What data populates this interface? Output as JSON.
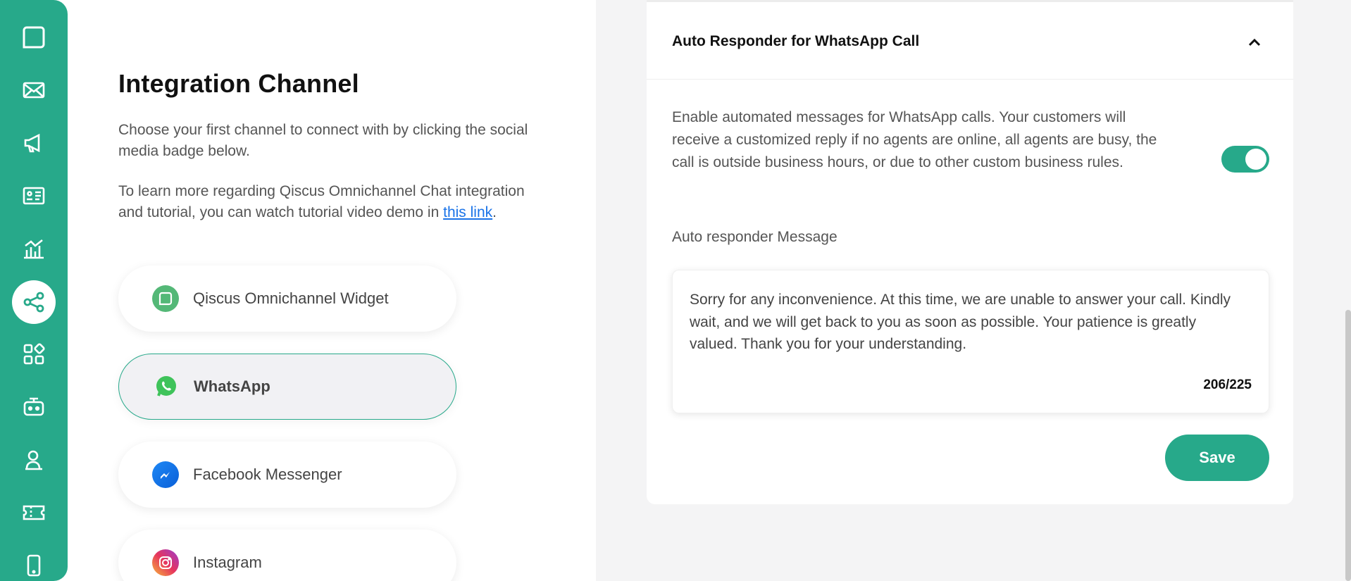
{
  "colors": {
    "accent": "#27a98a",
    "link": "#1a73e8",
    "background": "#f4f4f5"
  },
  "sidebar": {
    "items": [
      {
        "icon": "chat-bubble-logo-icon"
      },
      {
        "icon": "mail-icon"
      },
      {
        "icon": "megaphone-icon"
      },
      {
        "icon": "contact-card-icon"
      },
      {
        "icon": "analytics-chart-icon"
      },
      {
        "icon": "share-integration-icon",
        "active": true
      },
      {
        "icon": "apps-grid-icon"
      },
      {
        "icon": "bot-icon"
      },
      {
        "icon": "agent-icon"
      },
      {
        "icon": "ticket-icon"
      },
      {
        "icon": "mobile-phone-icon"
      }
    ]
  },
  "left": {
    "title": "Integration Channel",
    "desc1": "Choose your first channel to connect with by clicking the social media badge below.",
    "desc2_prefix": "To learn more regarding Qiscus Omnichannel Chat integration and tutorial, you can watch tutorial video demo in ",
    "desc2_link": "this link",
    "desc2_suffix": ".",
    "channels": [
      {
        "label": "Qiscus Omnichannel Widget",
        "icon": "qiscus-icon"
      },
      {
        "label": "WhatsApp",
        "icon": "whatsapp-icon",
        "selected": true
      },
      {
        "label": "Facebook Messenger",
        "icon": "messenger-icon"
      },
      {
        "label": "Instagram",
        "icon": "instagram-icon"
      }
    ]
  },
  "card": {
    "title": "Auto Responder for WhatsApp Call",
    "description": "Enable automated messages for WhatsApp calls. Your customers will receive a customized reply if no agents are online, all agents are busy, the call is outside business hours, or due to other custom business rules.",
    "toggle_on": true,
    "message_label": "Auto responder Message",
    "message": "Sorry for any inconvenience. At this time, we are unable to answer your call. Kindly wait, and we will get back to you as soon as possible. Your patience is greatly valued. Thank you for your understanding.",
    "char_count": "206/225",
    "save_label": "Save"
  }
}
